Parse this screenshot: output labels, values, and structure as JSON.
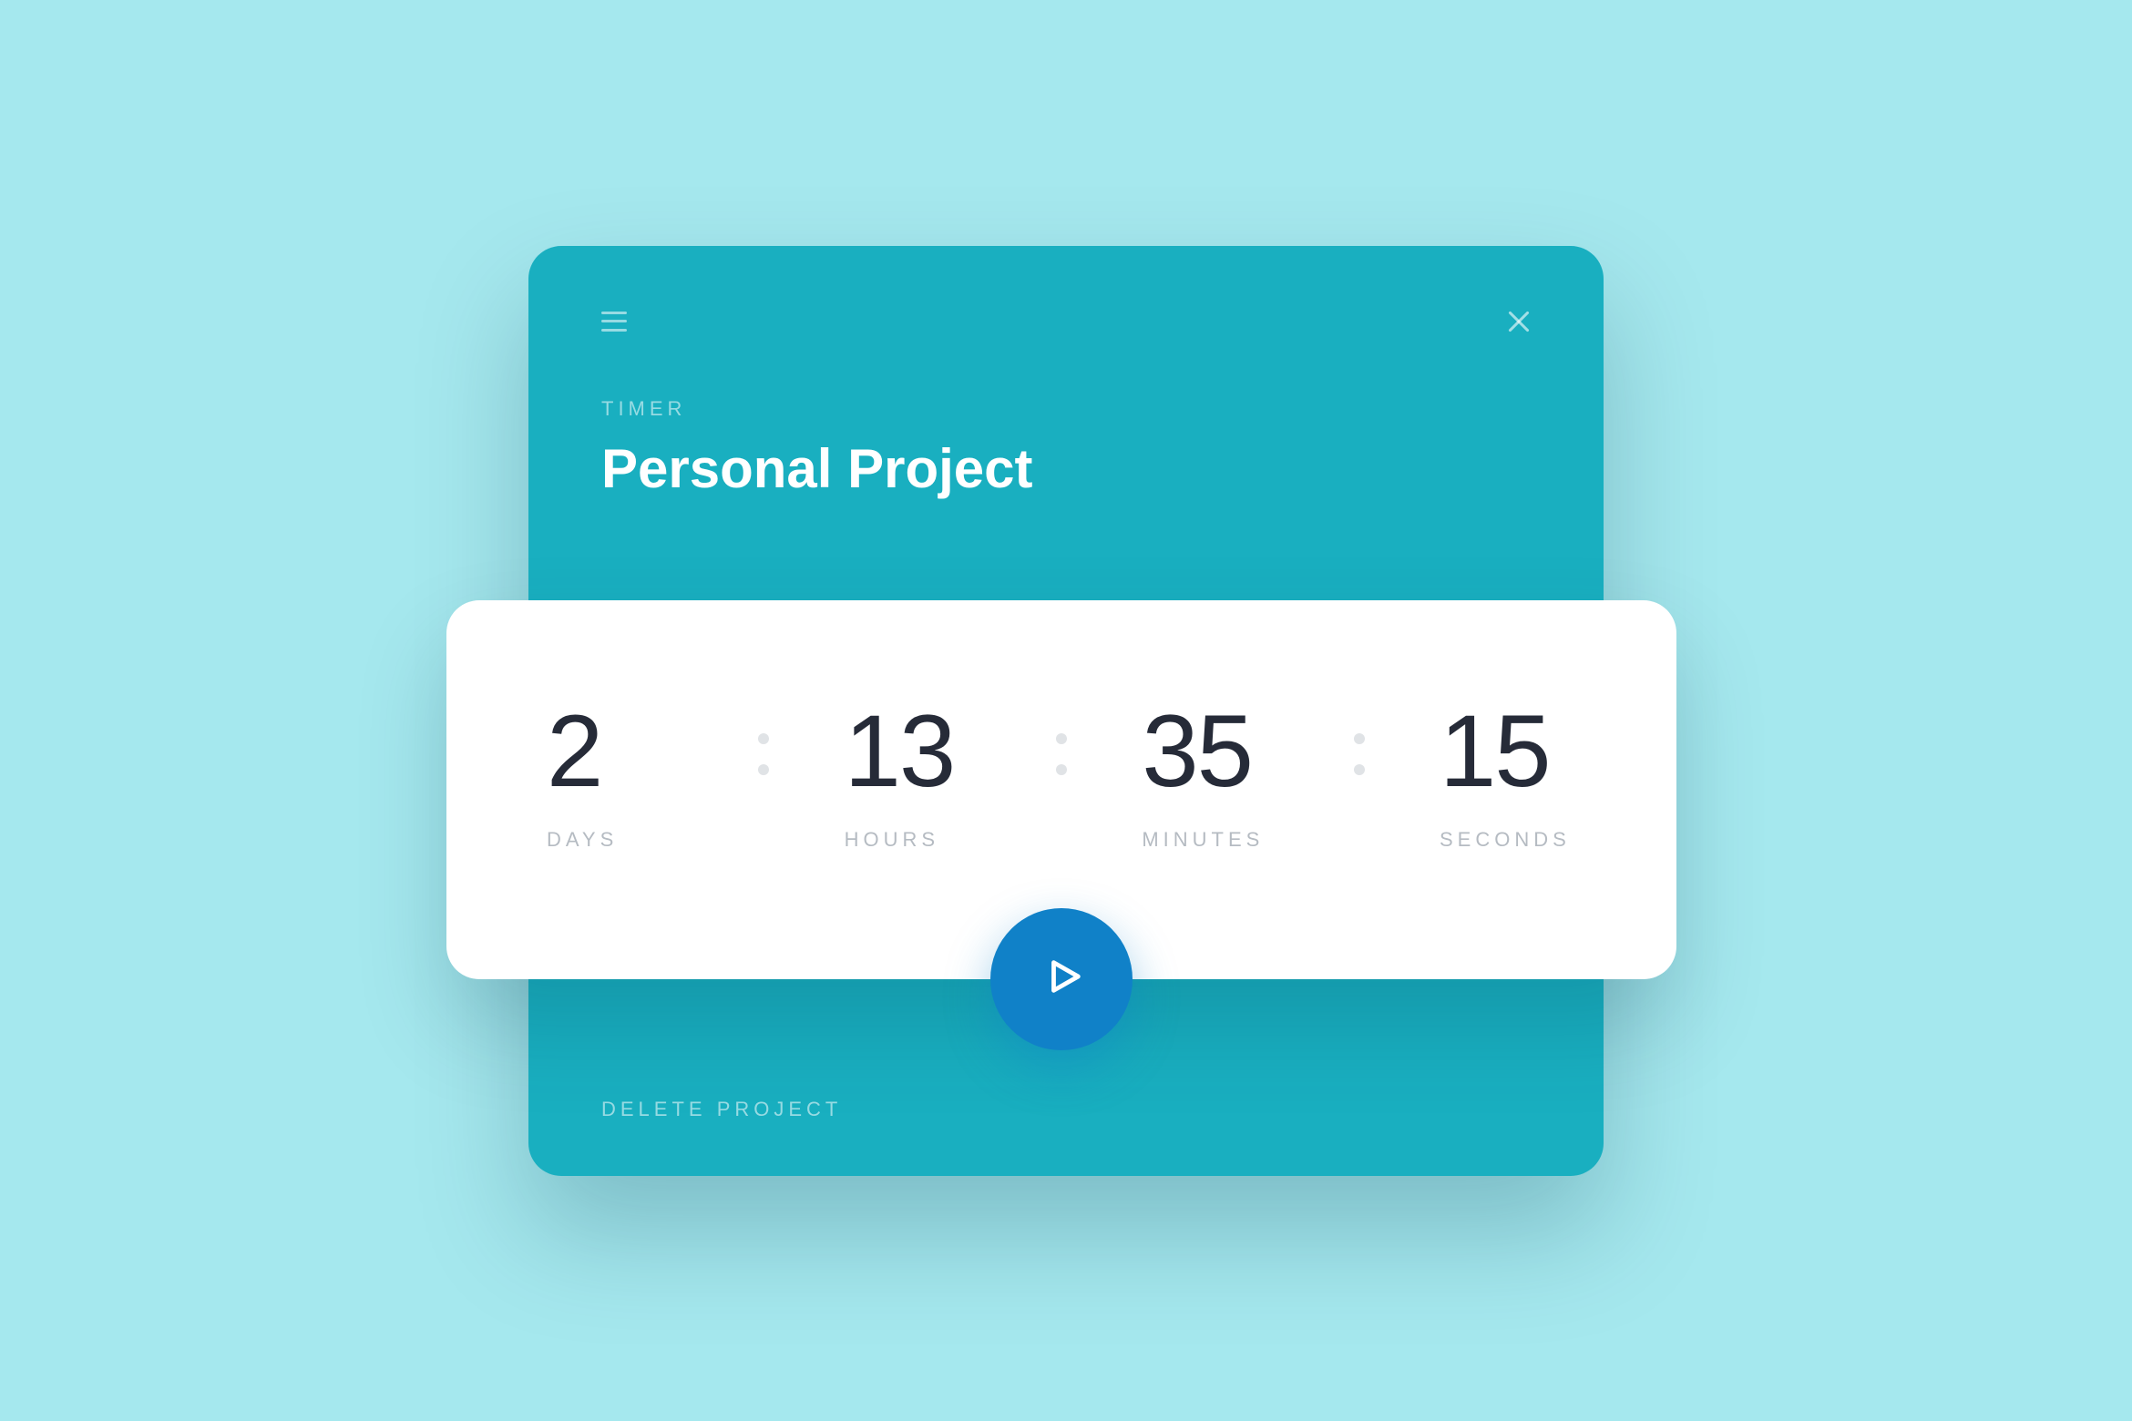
{
  "header": {
    "eyebrow": "TIMER",
    "title": "Personal Project"
  },
  "timer": {
    "days": {
      "value": "2",
      "label": "DAYS"
    },
    "hours": {
      "value": "13",
      "label": "HOURS"
    },
    "minutes": {
      "value": "35",
      "label": "MINUTES"
    },
    "seconds": {
      "value": "15",
      "label": "SECONDS"
    }
  },
  "actions": {
    "delete_label": "DELETE PROJECT"
  }
}
